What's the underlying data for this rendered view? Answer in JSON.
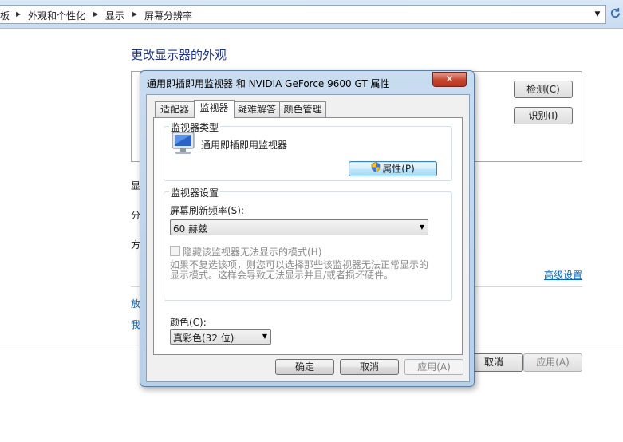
{
  "address_bar": {
    "crumbs": [
      "板",
      "外观和个性化",
      "显示",
      "屏幕分辨率"
    ],
    "dropdown_icon": "chevron-down-icon",
    "refresh_icon": "refresh-icon"
  },
  "background": {
    "page_title": "更改显示器的外观",
    "detect_button": "检测(C)",
    "identify_button": "识别(I)",
    "label_display": "显",
    "label_resolution": "分",
    "label_orientation": "方",
    "advanced_link": "高级设置",
    "link_1": "放",
    "link_2": "我",
    "cancel_button": "取消",
    "apply_button": "应用(A)"
  },
  "dialog": {
    "title": "通用即插即用监视器 和 NVIDIA GeForce 9600 GT 属性",
    "close_label": "✕",
    "tabs": [
      {
        "label": "适配器",
        "active": false
      },
      {
        "label": "监视器",
        "active": true
      },
      {
        "label": "疑难解答",
        "active": false
      },
      {
        "label": "颜色管理",
        "active": false
      }
    ],
    "monitor_type": {
      "legend": "监视器类型",
      "monitor_name": "通用即插即用监视器",
      "properties_button": "属性(P)"
    },
    "monitor_settings": {
      "legend": "监视器设置",
      "refresh_label": "屏幕刷新频率(S):",
      "refresh_value": "60 赫兹",
      "hide_modes_label": "隐藏该监视器无法显示的模式(H)",
      "hide_modes_checked": false,
      "info_line_1": "如果不复选该项，则您可以选择那些该监视器无法正常显示的",
      "info_line_2": "显示模式。这样会导致无法显示并且/或者损坏硬件。"
    },
    "colors": {
      "label": "颜色(C):",
      "value": "真彩色(32 位)"
    },
    "buttons": {
      "ok": "确定",
      "cancel": "取消",
      "apply": "应用(A)"
    }
  },
  "colors": {
    "title_blue": "#1e3287",
    "link_blue": "#0066cc",
    "close_red": "#c6452f"
  }
}
